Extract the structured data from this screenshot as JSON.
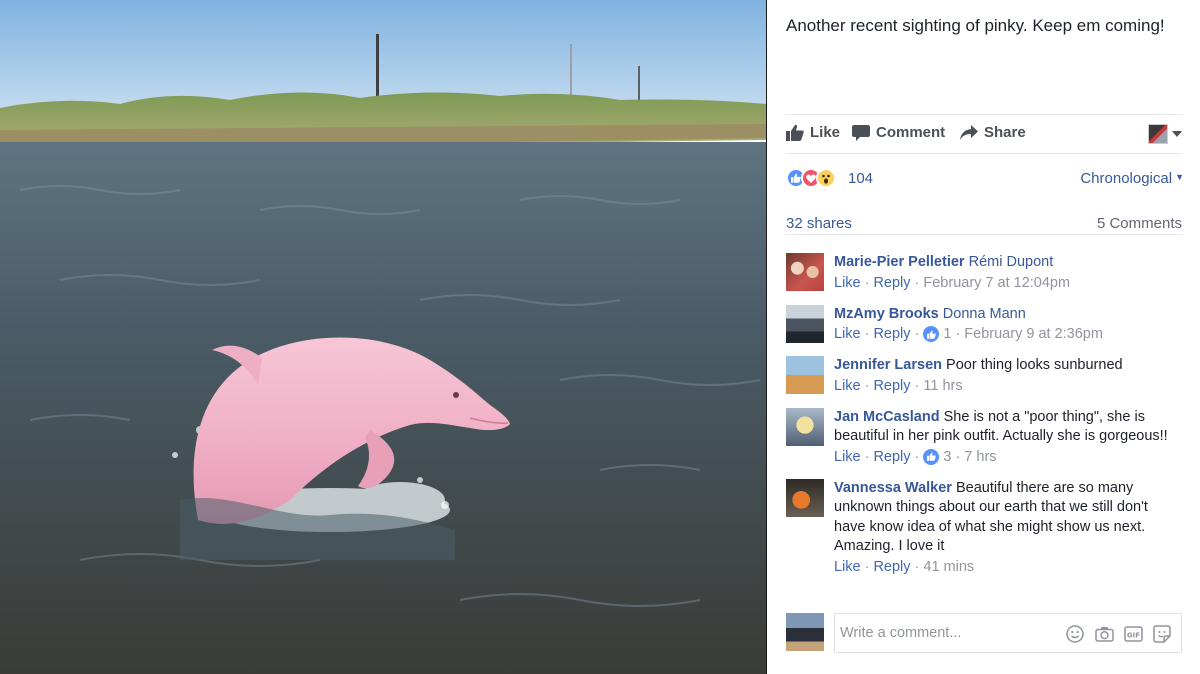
{
  "post": {
    "caption": "Another recent sighting of pinky. Keep em coming!"
  },
  "actions": {
    "like": "Like",
    "comment": "Comment",
    "share": "Share"
  },
  "reactions": {
    "types": [
      "like-reaction-icon",
      "love-reaction-icon",
      "wow-reaction-icon"
    ],
    "count": "104"
  },
  "sort": {
    "selected": "Chronological"
  },
  "meta": {
    "shares": "32 shares",
    "comments": "5 Comments"
  },
  "comments": [
    {
      "author": "Marie-Pier Pelletier",
      "tag": "Rémi Dupont",
      "text": "",
      "like": "Like",
      "reply": "Reply",
      "likes": "",
      "time": "February 7 at 12:04pm"
    },
    {
      "author": "MzAmy Brooks",
      "tag": "Donna Mann",
      "text": "",
      "like": "Like",
      "reply": "Reply",
      "likes": "1",
      "time": "February 9 at 2:36pm"
    },
    {
      "author": "Jennifer Larsen",
      "tag": "",
      "text": "Poor thing looks sunburned",
      "like": "Like",
      "reply": "Reply",
      "likes": "",
      "time": "11 hrs"
    },
    {
      "author": "Jan McCasland",
      "tag": "",
      "text": "She is not a \"poor thing\", she is beautiful in her pink outfit. Actually she is gorgeous!!",
      "like": "Like",
      "reply": "Reply",
      "likes": "3",
      "time": "7 hrs"
    },
    {
      "author": "Vannessa Walker",
      "tag": "",
      "text": "Beautiful there are so many unknown things about our earth that we still don't have know idea of what she might show us next. Amazing. I love it",
      "like": "Like",
      "reply": "Reply",
      "likes": "",
      "time": "41 mins"
    }
  ],
  "composer": {
    "placeholder": "Write a comment..."
  },
  "colors": {
    "link": "#385898",
    "author": "#365899",
    "muted": "#90949c",
    "like_blue": "#5890ff",
    "love_red": "#f25268",
    "wow_yellow": "#fcd15b",
    "dolphin_pink": "#f2b5c8"
  }
}
